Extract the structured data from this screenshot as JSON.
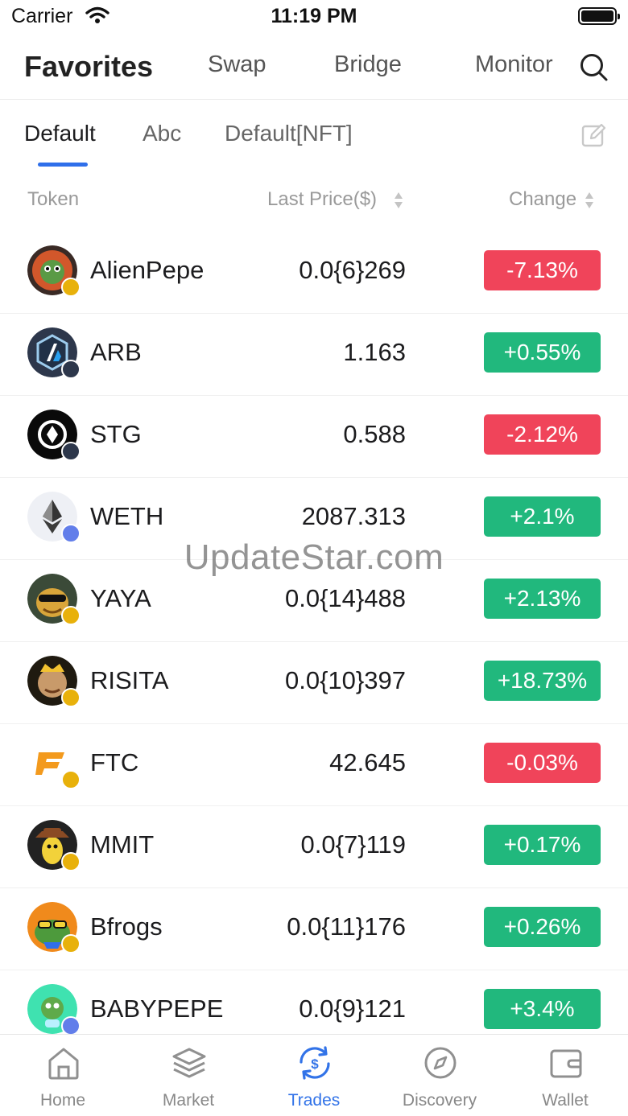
{
  "status_bar": {
    "carrier": "Carrier",
    "time": "11:19 PM"
  },
  "top_nav": {
    "items": [
      "Favorites",
      "Swap",
      "Bridge",
      "Monitor"
    ],
    "active": "Favorites"
  },
  "sub_tabs": {
    "items": [
      "Default",
      "Abc",
      "Default[NFT]"
    ],
    "active": "Default"
  },
  "columns": {
    "token": "Token",
    "last_price": "Last Price($)",
    "change": "Change"
  },
  "tokens": [
    {
      "symbol": "AlienPepe",
      "price": "0.0{6}269",
      "change": "-7.13%",
      "direction": "down",
      "chain": "bsc",
      "avatar_color": "#3a2a25"
    },
    {
      "symbol": "ARB",
      "price": "1.163",
      "change": "+0.55%",
      "direction": "up",
      "chain": "arb",
      "avatar_color": "#2d374b"
    },
    {
      "symbol": "STG",
      "price": "0.588",
      "change": "-2.12%",
      "direction": "down",
      "chain": "arb",
      "avatar_color": "#0a0a0a"
    },
    {
      "symbol": "WETH",
      "price": "2087.313",
      "change": "+2.1%",
      "direction": "up",
      "chain": "eth",
      "avatar_color": "#eef0f5"
    },
    {
      "symbol": "YAYA",
      "price": "0.0{14}488",
      "change": "+2.13%",
      "direction": "up",
      "chain": "bsc",
      "avatar_color": "#3b4a38"
    },
    {
      "symbol": "RISITA",
      "price": "0.0{10}397",
      "change": "+18.73%",
      "direction": "up",
      "chain": "bsc",
      "avatar_color": "#c89a1a"
    },
    {
      "symbol": "FTC",
      "price": "42.645",
      "change": "-0.03%",
      "direction": "down",
      "chain": "bsc",
      "avatar_color": "#ffffff"
    },
    {
      "symbol": "MMIT",
      "price": "0.0{7}119",
      "change": "+0.17%",
      "direction": "up",
      "chain": "bsc",
      "avatar_color": "#222222"
    },
    {
      "symbol": "Bfrogs",
      "price": "0.0{11}176",
      "change": "+0.26%",
      "direction": "up",
      "chain": "bsc",
      "avatar_color": "#f08a1c"
    },
    {
      "symbol": "BABYPEPE",
      "price": "0.0{9}121",
      "change": "+3.4%",
      "direction": "up",
      "chain": "eth",
      "avatar_color": "#3fe2b0"
    }
  ],
  "watermark": "UpdateStar.com",
  "tab_bar": {
    "items": [
      {
        "label": "Home",
        "icon": "home-icon"
      },
      {
        "label": "Market",
        "icon": "layers-icon"
      },
      {
        "label": "Trades",
        "icon": "trades-icon"
      },
      {
        "label": "Discovery",
        "icon": "compass-icon"
      },
      {
        "label": "Wallet",
        "icon": "wallet-icon"
      }
    ],
    "active": "Trades"
  },
  "colors": {
    "accent": "#3273e8",
    "up": "#21b87d",
    "down": "#f0445a"
  }
}
